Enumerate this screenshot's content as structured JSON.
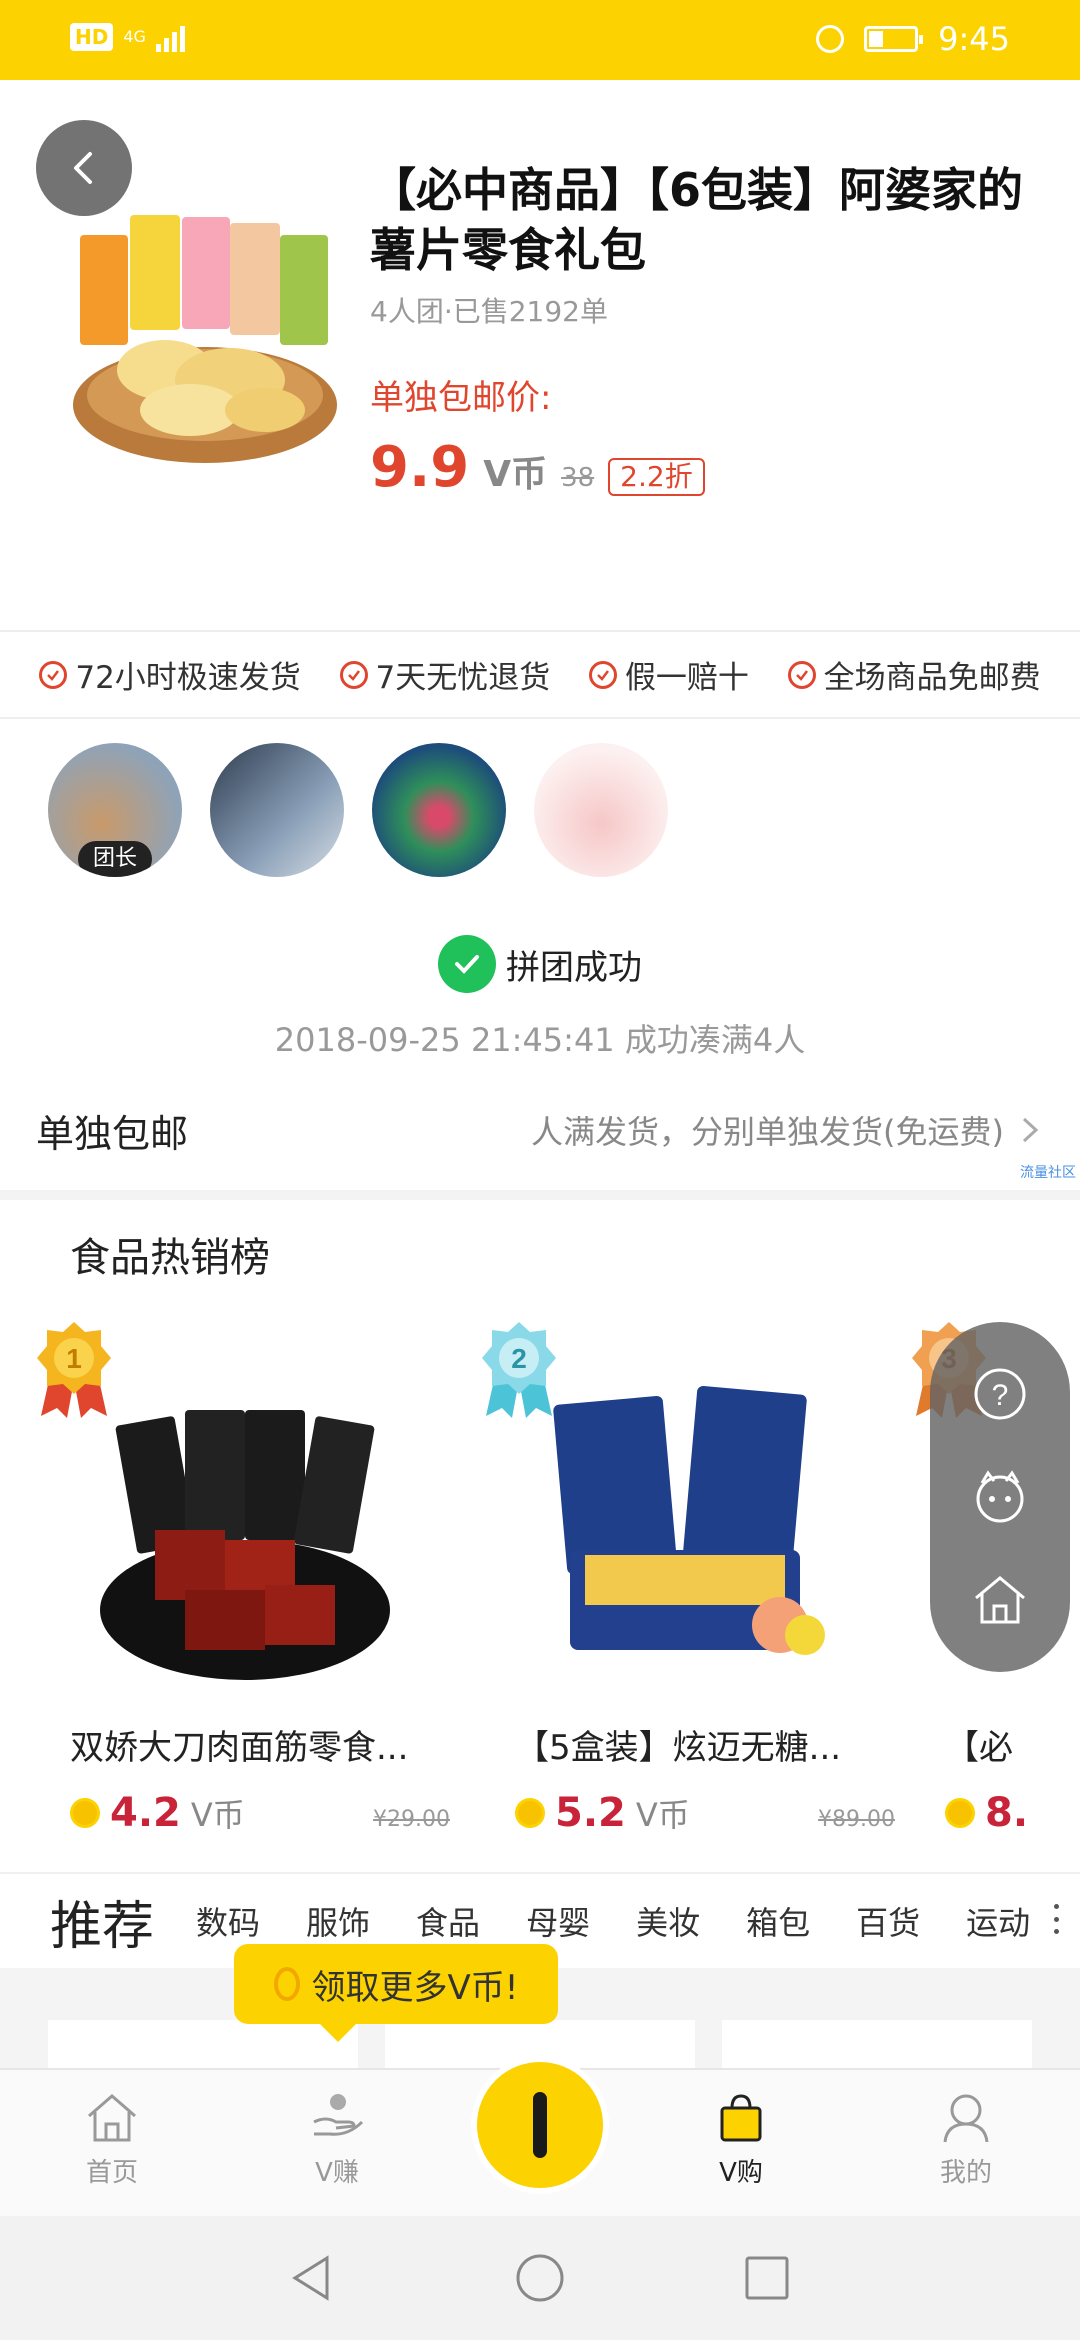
{
  "status_bar": {
    "hd": "HD",
    "network": "4G",
    "time": "9:45"
  },
  "product": {
    "title": "【必中商品】【6包装】阿婆家的薯片零食礼包",
    "sales": "4人团·已售2192单",
    "price_label": "单独包邮价:",
    "price": "9.9",
    "price_unit": "V币",
    "original_price": "38",
    "discount": "2.2折"
  },
  "guarantees": [
    "72小时极速发货",
    "7天无忧退货",
    "假一赔十",
    "全场商品免邮费"
  ],
  "group": {
    "leader_tag": "团长",
    "member_count": 4,
    "status": "拼团成功",
    "time_text": "2018-09-25 21:45:41 成功凑满4人"
  },
  "shipping": {
    "label": "单独包邮",
    "desc": "人满发货，分别单独发货(免运费)"
  },
  "watermark": "流量社区",
  "ranking": {
    "title": "食品热销榜",
    "items": [
      {
        "rank": "1",
        "name": "双娇大刀肉面筋零食...",
        "price": "4.2",
        "unit": "V币",
        "original": "¥29.00"
      },
      {
        "rank": "2",
        "name": "【5盒装】炫迈无糖...",
        "price": "5.2",
        "unit": "V币",
        "original": "¥89.00"
      },
      {
        "rank": "3",
        "name": "【必",
        "price": "8.",
        "unit": "",
        "original": ""
      }
    ]
  },
  "tabs": {
    "main": "推荐",
    "items": [
      "数码",
      "服饰",
      "食品",
      "母婴",
      "美妆",
      "箱包",
      "百货",
      "运动"
    ]
  },
  "tooltip": {
    "text": "领取更多V币!"
  },
  "bottom_nav": {
    "items": [
      {
        "label": "首页",
        "icon": "home-icon"
      },
      {
        "label": "V赚",
        "icon": "earn-icon"
      },
      {
        "label": "V购",
        "icon": "shopping-bag-icon",
        "active": true
      },
      {
        "label": "我的",
        "icon": "profile-icon"
      }
    ]
  },
  "colors": {
    "brand_yellow": "#FCD300",
    "price_red": "#e0452d",
    "success_green": "#20c15a"
  }
}
